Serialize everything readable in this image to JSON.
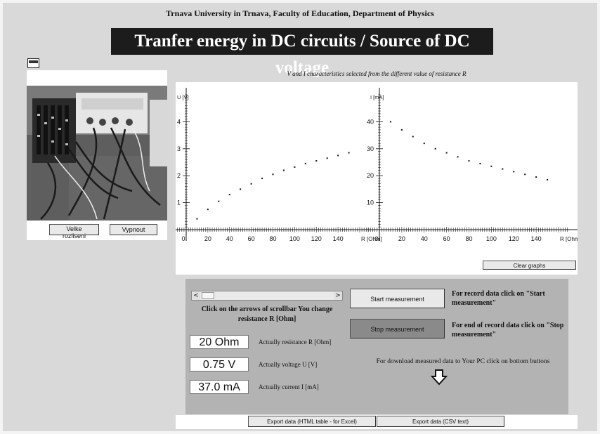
{
  "header": {
    "university": "Trnava University in Trnava, Faculty of Education, Department of Physics",
    "title": "Tranfer energy in DC circuits / Source of DC voltage"
  },
  "camera": {
    "high_res_label": "Velke rozliseni",
    "off_label": "Vypnout"
  },
  "graphs": {
    "caption_text": "V and I characteristics selected from the different value of resistance R",
    "clear_label": "Clear graphs"
  },
  "chart_data": [
    {
      "type": "scatter",
      "ylabel": "U [V]",
      "xlabel": "R [Ohm]",
      "xlim": [
        0,
        160
      ],
      "ylim": [
        0,
        5
      ],
      "xticks": [
        0,
        20,
        40,
        60,
        80,
        100,
        120,
        140
      ],
      "yticks": [
        1,
        2,
        3,
        4
      ],
      "x": [
        10,
        20,
        30,
        40,
        50,
        60,
        70,
        80,
        90,
        100,
        110,
        120,
        130,
        140,
        150
      ],
      "y": [
        0.4,
        0.75,
        1.05,
        1.3,
        1.5,
        1.7,
        1.9,
        2.05,
        2.2,
        2.32,
        2.45,
        2.55,
        2.65,
        2.75,
        2.85
      ]
    },
    {
      "type": "scatter",
      "ylabel": "I [mA]",
      "xlabel": "R [Ohm]",
      "xlim": [
        0,
        160
      ],
      "ylim": [
        0,
        50
      ],
      "xticks": [
        0,
        20,
        40,
        60,
        80,
        100,
        120,
        140
      ],
      "yticks": [
        10,
        20,
        30,
        40
      ],
      "x": [
        10,
        20,
        30,
        40,
        50,
        60,
        70,
        80,
        90,
        100,
        110,
        120,
        130,
        140,
        150
      ],
      "y": [
        40.0,
        37.0,
        34.5,
        32.0,
        30.0,
        28.5,
        27.0,
        25.5,
        24.5,
        23.5,
        22.5,
        21.5,
        20.5,
        19.5,
        18.5
      ]
    }
  ],
  "controls": {
    "scroll_left": "<",
    "scroll_right": ">",
    "scroll_hint": "Click on the arrows of scrollbar You change resistance R [Ohm]",
    "resistance_value": "20 Ohm",
    "resistance_label": "Actually resistance R [Ohm]",
    "voltage_value": "0.75 V",
    "voltage_label": "Actually voltage U [V]",
    "current_value": "37.0 mA",
    "current_label": "Actually current I [mA]",
    "start_label": "Start measurement",
    "stop_label": "Stop measurement",
    "start_hint": "For record data click on \"Start measurement\"",
    "stop_hint": "For end of record data click on \"Stop measurement\"",
    "download_hint": "For download measured data to Your PC click on bottom buttons"
  },
  "export": {
    "html_label": "Export data (HTML table - for Excel)",
    "csv_label": "Export data (CSV text)"
  },
  "colors": {
    "panel": "#b3b3b3",
    "title_bg": "#1c1c1c",
    "stop_button": "#8a8a8a",
    "marker": "#111111"
  }
}
